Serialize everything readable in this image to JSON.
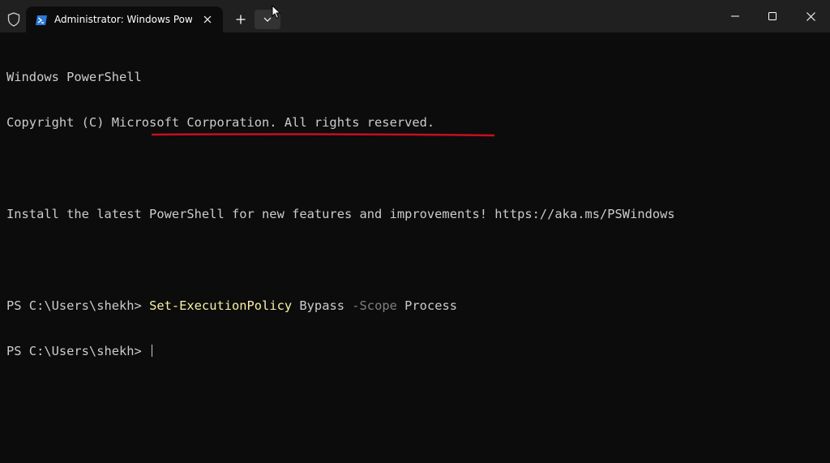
{
  "window": {
    "tab_title": "Administrator: Windows PowerShell",
    "icons": {
      "shield": "shield-icon",
      "tab": "powershell-icon",
      "close_tab": "close-icon",
      "new_tab": "plus-icon",
      "dropdown": "chevron-down-icon",
      "minimize": "minimize-icon",
      "maximize": "maximize-icon",
      "close": "close-icon"
    }
  },
  "console": {
    "header_line1": "Windows PowerShell",
    "header_line2": "Copyright (C) Microsoft Corporation. All rights reserved.",
    "install_line": "Install the latest PowerShell for new features and improvements! https://aka.ms/PSWindows",
    "prompt": "PS C:\\Users\\shekh> ",
    "command": {
      "cmdlet": "Set-ExecutionPolicy",
      "arg1": " Bypass ",
      "param": "-Scope",
      "arg2": " Process"
    }
  },
  "colors": {
    "background": "#0c0c0c",
    "titlebar": "#202020",
    "text": "#cccccc",
    "cmdlet": "#f9f1a5",
    "parameter": "#7f7f7f",
    "annotation_underline": "#c50f1f"
  }
}
